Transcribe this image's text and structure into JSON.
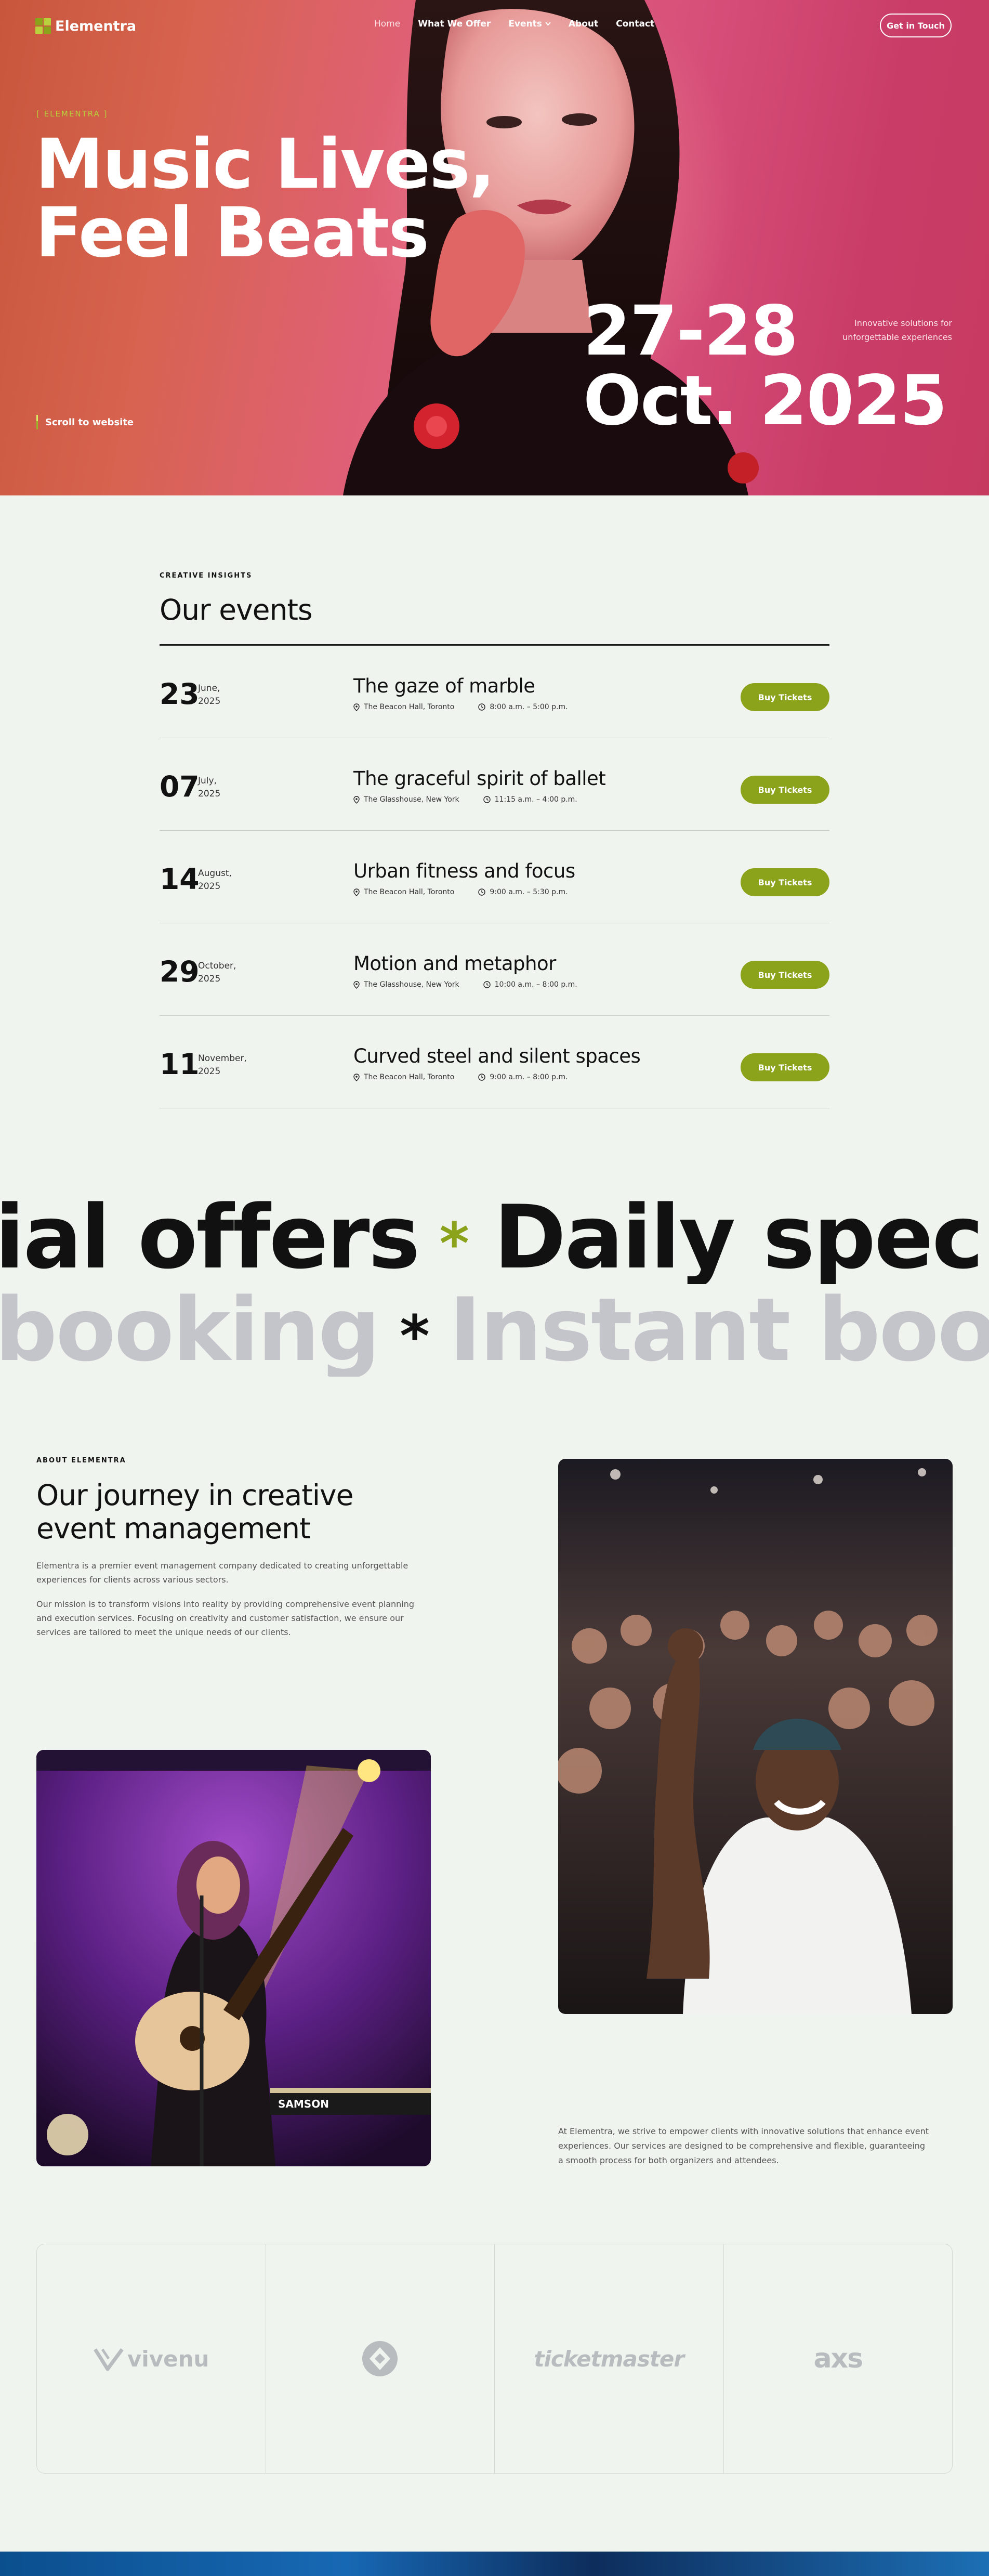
{
  "brand": {
    "name": "Elementra",
    "accent": "#8ba21b"
  },
  "nav": {
    "links": [
      {
        "label": "Home",
        "active": true
      },
      {
        "label": "What We Offer",
        "active": false
      },
      {
        "label": "Events",
        "active": false,
        "has_dropdown": true
      },
      {
        "label": "About",
        "active": false
      },
      {
        "label": "Contact",
        "active": false
      }
    ],
    "cta": "Get in Touch"
  },
  "hero": {
    "tag": "[ ELEMENTRA ]",
    "title_line1": "Music Lives,",
    "title_line2": "Feel Beats",
    "date_line1": "27-28",
    "date_line2": "Oct. 2025",
    "subtitle_line1": "Innovative solutions for",
    "subtitle_line2": "unforgettable experiences",
    "scroll_label": "Scroll to website"
  },
  "events": {
    "eyebrow": "CREATIVE INSIGHTS",
    "title": "Our events",
    "button_label": "Buy Tickets",
    "items": [
      {
        "day": "23",
        "month": "June,",
        "year": "2025",
        "title": "The gaze of marble",
        "venue": "The Beacon Hall, Toronto",
        "time": "8:00 a.m. – 5:00 p.m."
      },
      {
        "day": "07",
        "month": "July,",
        "year": "2025",
        "title": "The graceful spirit of ballet",
        "venue": "The Glasshouse, New York",
        "time": "11:15 a.m. – 4:00 p.m."
      },
      {
        "day": "14",
        "month": "August,",
        "year": "2025",
        "title": "Urban fitness and focus",
        "venue": "The Beacon Hall, Toronto",
        "time": "9:00 a.m. – 5:30 p.m."
      },
      {
        "day": "29",
        "month": "October,",
        "year": "2025",
        "title": "Motion and metaphor",
        "venue": "The Glasshouse, New York",
        "time": "10:00 a.m. – 8:00 p.m."
      },
      {
        "day": "11",
        "month": "November,",
        "year": "2025",
        "title": "Curved steel and silent spaces",
        "venue": "The Beacon Hall, Toronto",
        "time": "9:00 a.m. – 8:00 p.m."
      }
    ]
  },
  "marquee": {
    "row1_a": "ial offers",
    "row1_star": "*",
    "row1_b": "Daily special offers",
    "row2_a": "booking",
    "row2_star": "*",
    "row2_b": "Instant booking"
  },
  "about": {
    "eyebrow": "ABOUT ELEMENTRA",
    "title_line1": "Our journey in creative",
    "title_line2": "event management",
    "p1": "Elementra is a premier event management company dedicated to creating unforgettable experiences for clients across various sectors.",
    "p2": "Our mission is to transform visions into reality by providing comprehensive event planning and execution services. Focusing on creativity and customer satisfaction, we ensure our services are tailored to meet the unique needs of our clients.",
    "p3": "At Elementra, we strive to empower clients with innovative solutions that enhance event experiences. Our services are designed to be comprehensive and flexible, guaranteeing a smooth process for both organizers and attendees.",
    "keyboard_brand": "SAMSON"
  },
  "partners": [
    {
      "name": "vivenu",
      "icon": "vivenu-logo"
    },
    {
      "name": "",
      "icon": "circle-diamond-logo"
    },
    {
      "name": "ticketmaster",
      "icon": "ticketmaster-logo"
    },
    {
      "name": "axs",
      "icon": "axs-logo"
    }
  ]
}
